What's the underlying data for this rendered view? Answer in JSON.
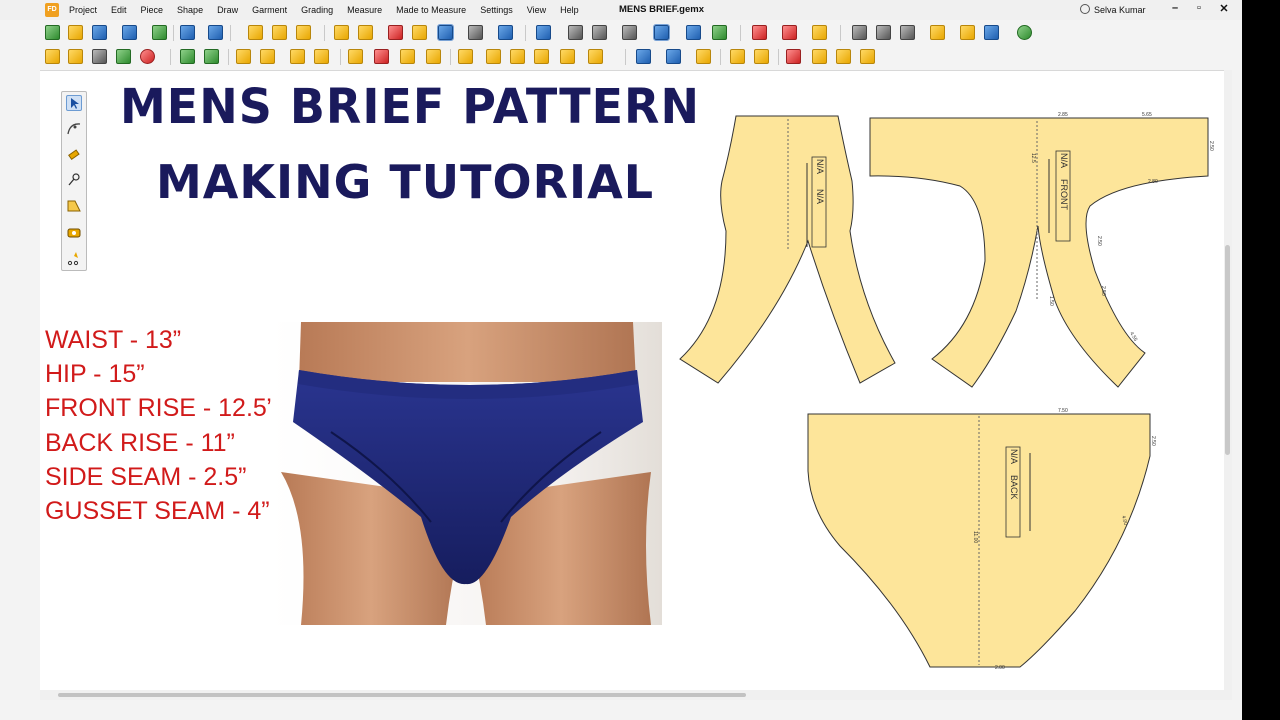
{
  "app": {
    "logo_text": "FD",
    "menu": [
      "Project",
      "Edit",
      "Piece",
      "Shape",
      "Draw",
      "Garment",
      "Grading",
      "Measure",
      "Made to Measure",
      "Settings",
      "View",
      "Help"
    ],
    "document_title": "MENS BRIEF.gemx",
    "user_name": "Selva Kumar",
    "window_controls": {
      "minimize": "–",
      "restore": "▫",
      "close": "✕"
    }
  },
  "tutorial": {
    "title_line1": "MENS BRIEF PATTERN",
    "title_line2": "MAKING TUTORIAL",
    "measurements": [
      "WAIST - 13”",
      "HIP - 15”",
      "FRONT RISE - 12.5”",
      "BACK RISE - 11”",
      "SIDE SEAM - 2.5”",
      "GUSSET SEAM - 4”"
    ]
  },
  "pieces": {
    "left": {
      "label1": "N/A",
      "label2": "N/A"
    },
    "front": {
      "label1": "N/A",
      "label2": "FRONT",
      "dims": [
        "2.85",
        "5.65",
        "2.50",
        "2.50",
        "2.50",
        "12.5",
        "2.80",
        "1.50",
        "4.55"
      ]
    },
    "back": {
      "label1": "N/A",
      "label2": "BACK",
      "dims": [
        "7.50",
        "2.50",
        "11.00",
        "4.00",
        "2.00"
      ]
    }
  },
  "colors": {
    "pattern_fill": "#fde59a",
    "heading": "#1a1a5c",
    "measure_text": "#d11a1a",
    "brief": "#1e2a7a"
  }
}
